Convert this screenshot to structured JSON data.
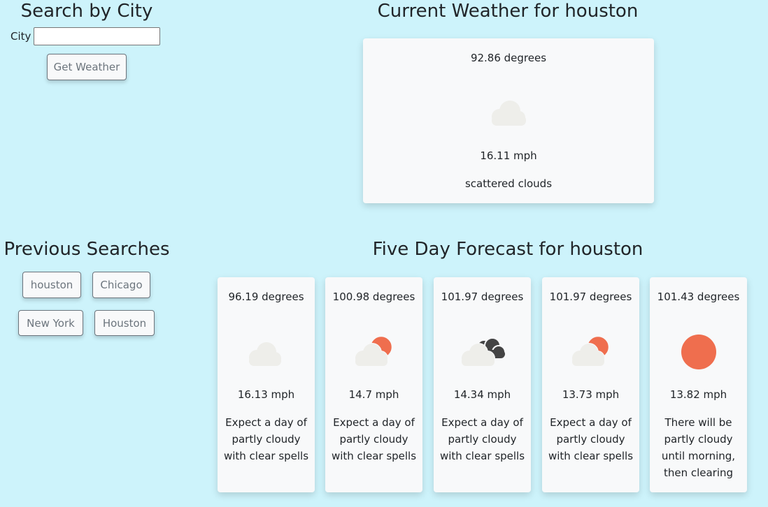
{
  "search": {
    "title": "Search by City",
    "city_label": "City",
    "city_value": "",
    "button_label": "Get Weather"
  },
  "current": {
    "title": "Current Weather for houston",
    "temp": "92.86 degrees",
    "icon": "cloud-icon",
    "wind": "16.11 mph",
    "desc": "scattered clouds"
  },
  "previous": {
    "title": "Previous Searches",
    "items": [
      "houston",
      "Chicago",
      "New York",
      "Houston"
    ]
  },
  "forecast": {
    "title": "Five Day Forecast for houston",
    "days": [
      {
        "temp": "96.19 degrees",
        "icon": "cloud-icon",
        "wind": "16.13 mph",
        "desc": "Expect a day of partly cloudy with clear spells"
      },
      {
        "temp": "100.98 degrees",
        "icon": "partly-cloudy-icon",
        "wind": "14.7 mph",
        "desc": "Expect a day of partly cloudy with clear spells"
      },
      {
        "temp": "101.97 degrees",
        "icon": "broken-clouds-icon",
        "wind": "14.34 mph",
        "desc": "Expect a day of partly cloudy with clear spells"
      },
      {
        "temp": "101.97 degrees",
        "icon": "partly-cloudy-icon",
        "wind": "13.73 mph",
        "desc": "Expect a day of partly cloudy with clear spells"
      },
      {
        "temp": "101.43 degrees",
        "icon": "sun-icon",
        "wind": "13.82 mph",
        "desc": "There will be partly cloudy until morning, then clearing"
      }
    ]
  },
  "colors": {
    "background": "#cdf3fb",
    "card": "#f8f9fa",
    "cloud_light": "#eeeeea",
    "cloud_dark": "#444444",
    "sun": "#ef6e4e",
    "button_text": "#6c757d"
  }
}
